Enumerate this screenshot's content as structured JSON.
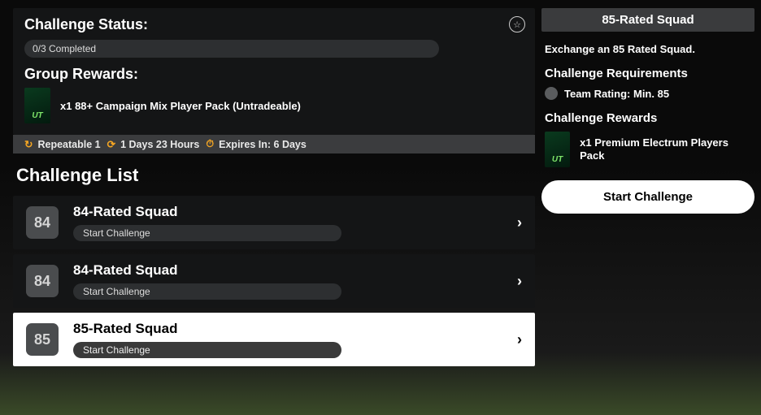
{
  "status": {
    "title": "Challenge Status:",
    "progress_text": "0/3 Completed",
    "rewards_title": "Group Rewards:",
    "reward_pack_tag": "UT",
    "reward_text": "x1 88+ Campaign Mix Player Pack (Untradeable)"
  },
  "meta": {
    "repeatable_label": "Repeatable 1",
    "refresh_label": "1 Days 23 Hours",
    "expires_label": "Expires In: 6 Days"
  },
  "list_header": "Challenge List",
  "challenges": [
    {
      "rating": "84",
      "name": "84-Rated Squad",
      "action": "Start Challenge",
      "selected": false
    },
    {
      "rating": "84",
      "name": "84-Rated Squad",
      "action": "Start Challenge",
      "selected": false
    },
    {
      "rating": "85",
      "name": "85-Rated Squad",
      "action": "Start Challenge",
      "selected": true
    }
  ],
  "detail": {
    "title": "85-Rated Squad",
    "description": "Exchange an 85 Rated Squad.",
    "requirements_title": "Challenge Requirements",
    "requirement_text": "Team Rating: Min. 85",
    "rewards_title": "Challenge Rewards",
    "reward_pack_tag": "UT",
    "reward_text": "x1 Premium Electrum Players Pack",
    "start_button": "Start Challenge"
  }
}
